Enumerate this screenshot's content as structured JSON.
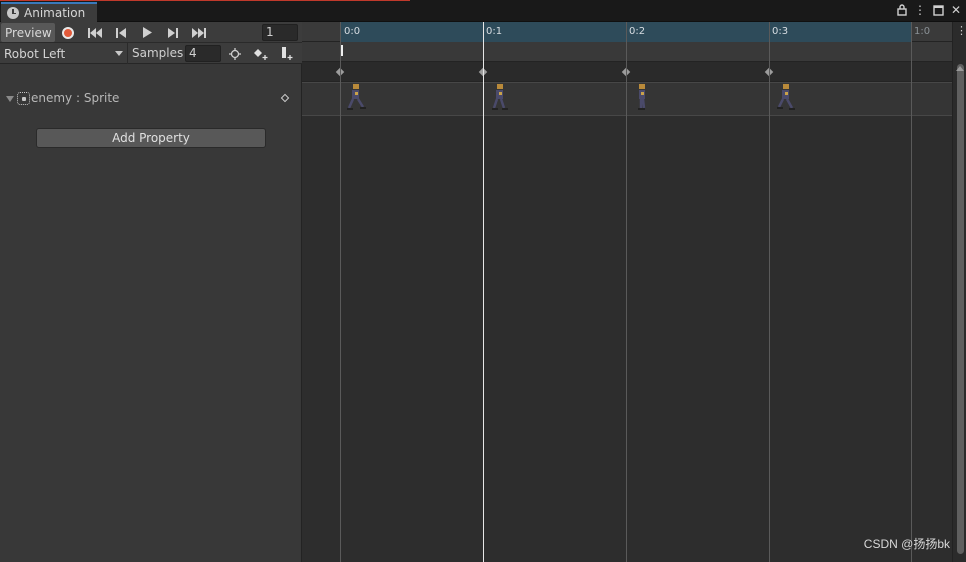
{
  "window": {
    "tab_title": "Animation",
    "tab_icon": "clock-icon",
    "controls": [
      "lock-icon",
      "kebab-menu-icon",
      "maximize-icon",
      "close-icon"
    ]
  },
  "toolbar": {
    "preview_label": "Preview",
    "record_icon": "record-icon",
    "first_key_icon": "first-keyframe-icon",
    "prev_key_icon": "previous-keyframe-icon",
    "play_icon": "play-icon",
    "next_key_icon": "next-keyframe-icon",
    "last_key_icon": "last-keyframe-icon",
    "current_frame": "1"
  },
  "clip_bar": {
    "clip_name": "Robot Left",
    "samples_label": "Samples",
    "samples_value": "4",
    "filter_icon": "filter-by-selection-icon",
    "add_keyframe_icon": "add-keyframe-icon",
    "add_event_icon": "add-event-icon"
  },
  "properties": [
    {
      "name": "enemy : Sprite",
      "icon": "sprite-icon"
    }
  ],
  "add_property_label": "Add Property",
  "timeline": {
    "ticks": [
      "0:0",
      "0:1",
      "0:2",
      "0:3",
      "1:0"
    ],
    "keyframes": [
      0,
      1,
      2,
      3
    ],
    "current_time_index": 1
  },
  "watermark": "CSDN @扬扬bk",
  "colors": {
    "record": "#e25a3a",
    "ruler_active": "#2e4b5a",
    "tab_accent": "#3a79bb"
  }
}
